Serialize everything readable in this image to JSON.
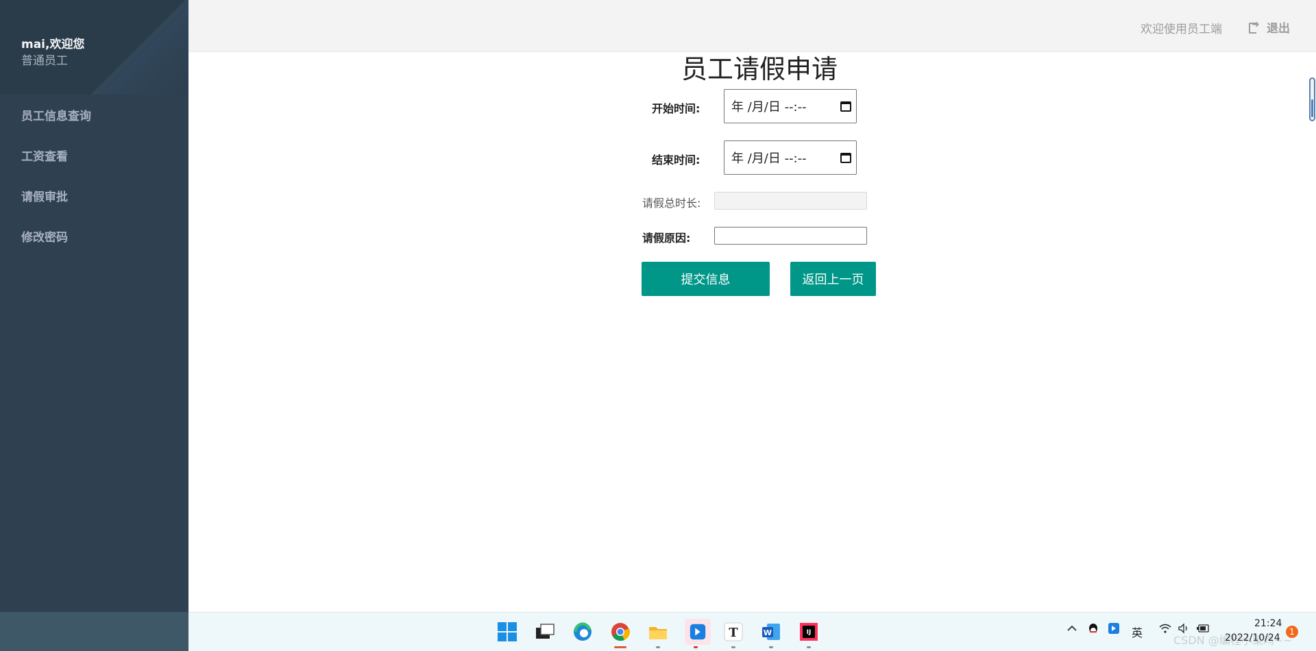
{
  "sidebar": {
    "user_name": "mai,欢迎您",
    "user_role": "普通员工",
    "items": [
      {
        "label": "员工信息查询"
      },
      {
        "label": "工资查看"
      },
      {
        "label": "请假审批"
      },
      {
        "label": "修改密码"
      }
    ]
  },
  "header": {
    "welcome_text": "欢迎使用员工端",
    "logout_label": "退出",
    "logout_icon": "sign-out-icon"
  },
  "form": {
    "title": "员工请假申请",
    "start_label": "开始时间:",
    "start_value": "年 /月/日 --:--",
    "end_label": "结束时间:",
    "end_value": "年 /月/日 --:--",
    "duration_label": "请假总时长:",
    "duration_value": "",
    "reason_label": "请假原因:",
    "reason_value": "",
    "submit_label": "提交信息",
    "back_label": "返回上一页"
  },
  "colors": {
    "sidebar_bg": "#2f4050",
    "button_bg": "#009688",
    "header_bg": "#f3f3f4"
  },
  "taskbar": {
    "apps": [
      "windows-start-icon",
      "task-view-icon",
      "edge-icon",
      "chrome-icon",
      "file-explorer-icon",
      "app-icon",
      "typora-icon",
      "word-icon",
      "intellij-icon"
    ],
    "tray_language": "英",
    "time": "21:24",
    "date": "2022/10/24",
    "notification_count": "1",
    "watermark": "CSDN @编程小菜鸡~~"
  }
}
